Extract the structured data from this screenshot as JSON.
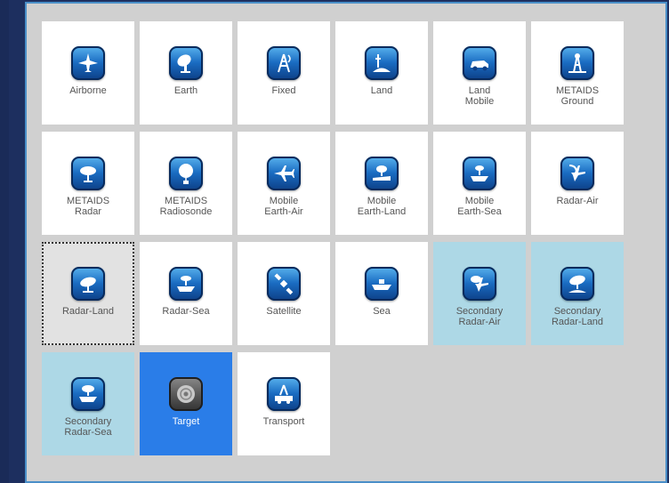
{
  "tiles": [
    {
      "id": "airborne",
      "label": "Airborne",
      "icon": "airplane-icon",
      "state": "normal"
    },
    {
      "id": "earth",
      "label": "Earth",
      "icon": "satellite-dish-icon",
      "state": "normal"
    },
    {
      "id": "fixed",
      "label": "Fixed",
      "icon": "antenna-tower-icon",
      "state": "normal"
    },
    {
      "id": "land",
      "label": "Land",
      "icon": "land-antenna-icon",
      "state": "normal"
    },
    {
      "id": "land-mobile",
      "label": "Land\nMobile",
      "icon": "car-icon",
      "state": "normal"
    },
    {
      "id": "metaids-ground",
      "label": "METAIDS\nGround",
      "icon": "meteorological-tower-icon",
      "state": "normal"
    },
    {
      "id": "metaids-radar",
      "label": "METAIDS\nRadar",
      "icon": "weather-radar-icon",
      "state": "normal"
    },
    {
      "id": "metaids-radiosonde",
      "label": "METAIDS\nRadiosonde",
      "icon": "radiosonde-balloon-icon",
      "state": "normal"
    },
    {
      "id": "mobile-earth-air",
      "label": "Mobile\nEarth-Air",
      "icon": "airplane-dish-icon",
      "state": "normal"
    },
    {
      "id": "mobile-earth-land",
      "label": "Mobile\nEarth-Land",
      "icon": "vehicle-dish-icon",
      "state": "normal"
    },
    {
      "id": "mobile-earth-sea",
      "label": "Mobile\nEarth-Sea",
      "icon": "ship-dish-icon",
      "state": "normal"
    },
    {
      "id": "radar-air",
      "label": "Radar-Air",
      "icon": "radar-airplane-icon",
      "state": "normal"
    },
    {
      "id": "radar-land",
      "label": "Radar-Land",
      "icon": "radar-dish-icon",
      "state": "focused"
    },
    {
      "id": "radar-sea",
      "label": "Radar-Sea",
      "icon": "radar-ship-icon",
      "state": "normal"
    },
    {
      "id": "satellite",
      "label": "Satellite",
      "icon": "satellite-icon",
      "state": "normal"
    },
    {
      "id": "sea",
      "label": "Sea",
      "icon": "ship-icon",
      "state": "normal"
    },
    {
      "id": "secondary-radar-air",
      "label": "Secondary\nRadar-Air",
      "icon": "secondary-radar-air-icon",
      "state": "selected-light"
    },
    {
      "id": "secondary-radar-land",
      "label": "Secondary\nRadar-Land",
      "icon": "secondary-radar-land-icon",
      "state": "selected-light"
    },
    {
      "id": "secondary-radar-sea",
      "label": "Secondary\nRadar-Sea",
      "icon": "secondary-radar-sea-icon",
      "state": "selected-light"
    },
    {
      "id": "target",
      "label": "Target",
      "icon": "target-disc-icon",
      "state": "selected"
    },
    {
      "id": "transport",
      "label": "Transport",
      "icon": "transport-truck-icon",
      "state": "normal"
    }
  ],
  "colors": {
    "panel_bg": "#d0d0d0",
    "panel_border": "#4a8fc8",
    "selected_light": "#add8e6",
    "selected": "#2a7de8",
    "outer_bg": "#1d2f5f"
  }
}
